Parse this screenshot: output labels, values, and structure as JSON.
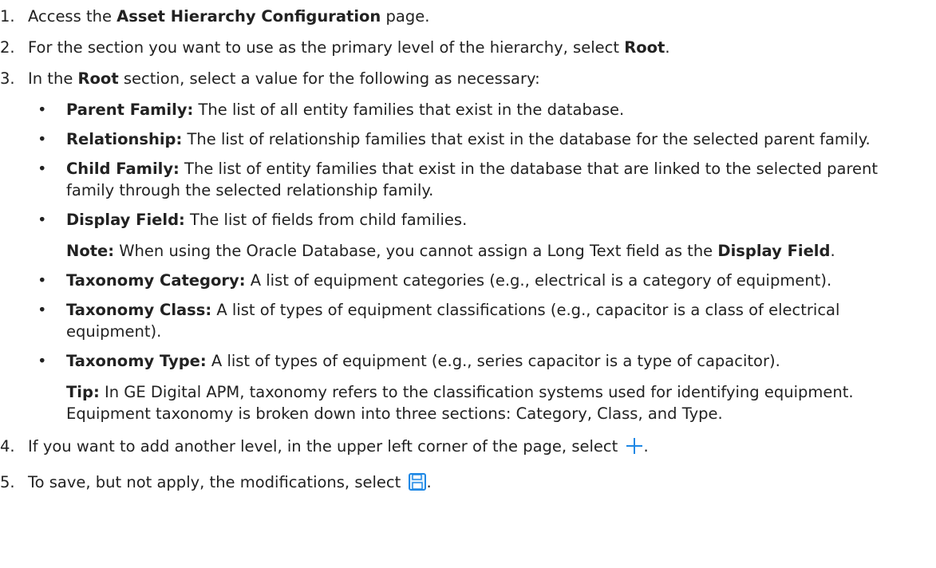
{
  "steps": [
    {
      "num": "1.",
      "pre": "Access the ",
      "b1": "Asset Hierarchy Configuration",
      "post": " page."
    },
    {
      "num": "2.",
      "pre": "For the section you want to use as the primary level of the hierarchy, select ",
      "b1": "Root",
      "post": "."
    },
    {
      "num": "3.",
      "pre": "In the ",
      "b1": "Root",
      "post": " section, select a value for the following as necessary:"
    },
    {
      "num": "4.",
      "pre": "If you want to add another level, in the upper left corner of the page, select ",
      "post": "."
    },
    {
      "num": "5.",
      "pre": "To save, but not apply, the modifications, select ",
      "post": "."
    }
  ],
  "bullet": "•",
  "options": [
    {
      "label": "Parent Family:",
      "text": " The list of all entity families that exist in the database."
    },
    {
      "label": "Relationship:",
      "text": " The list of relationship families that exist in the database for the selected parent family."
    },
    {
      "label": "Child Family:",
      "text": " The list of entity families that exist in the database that are linked to the selected parent family through the selected relationship family."
    },
    {
      "label": "Display Field:",
      "text": " The list of fields from child families."
    },
    {
      "label": "Taxonomy Category:",
      "text": " A list of equipment categories (e.g., electrical is a category of equipment)."
    },
    {
      "label": "Taxonomy Class:",
      "text": " A list of types of equipment classifications (e.g., capacitor is a class of electrical equipment)."
    },
    {
      "label": "Taxonomy Type:",
      "text": " A list of types of equipment (e.g., series capacitor is a type of capacitor)."
    }
  ],
  "note": {
    "label": "Note:",
    "text": " When using the Oracle Database, you cannot assign a Long Text field as the ",
    "bold_end": "Display Field",
    "end": "."
  },
  "tip": {
    "label": "Tip:",
    "text": " In GE Digital APM, taxonomy refers to the classification systems used for identifying equipment. Equipment taxonomy is broken down into three sections: Category, Class, and Type."
  },
  "icons": {
    "add": "plus-icon",
    "save": "save-icon",
    "accent": "#1e88e5"
  }
}
